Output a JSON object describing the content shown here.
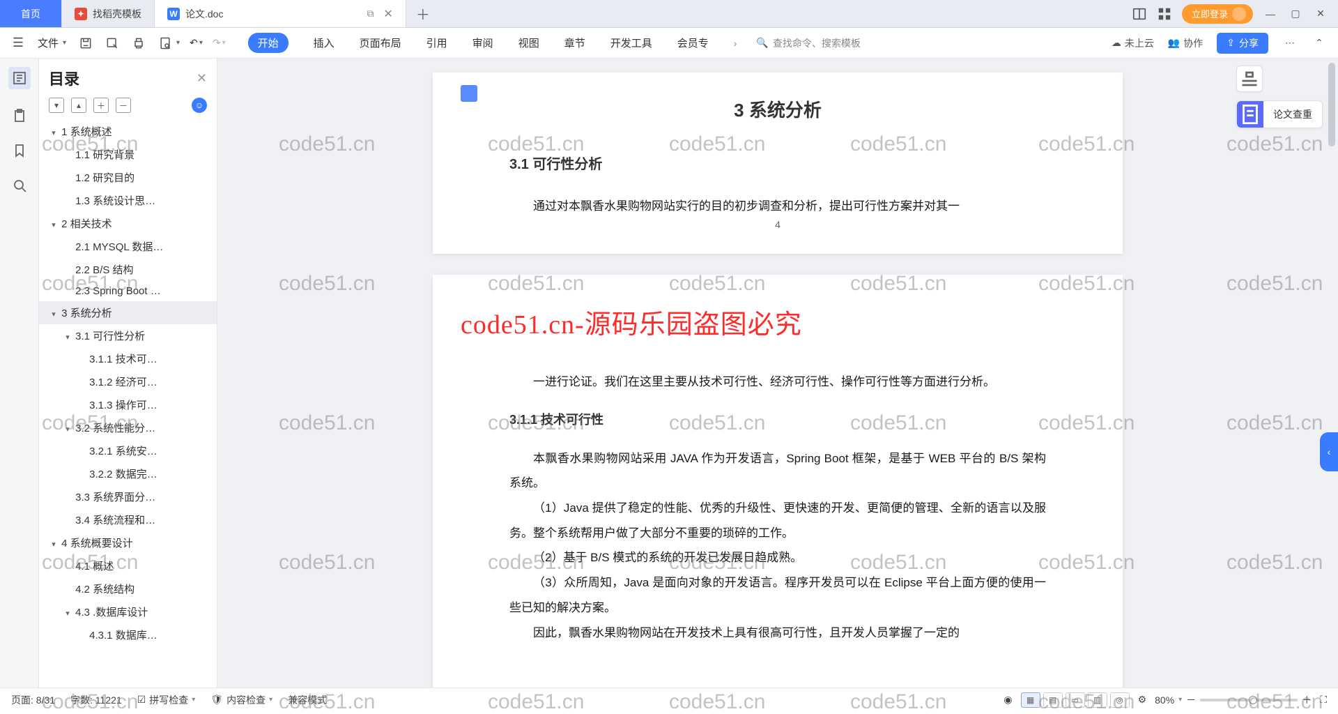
{
  "tabs": {
    "home": "首页",
    "t1": "找稻壳模板",
    "t2": "论文.doc",
    "login": "立即登录"
  },
  "menubar": {
    "file": "文件",
    "items": [
      "开始",
      "插入",
      "页面布局",
      "引用",
      "审阅",
      "视图",
      "章节",
      "开发工具",
      "会员专"
    ],
    "search": "查找命令、搜索模板",
    "cloud": "未上云",
    "collab": "协作",
    "share": "分享"
  },
  "outline": {
    "title": "目录",
    "tree": [
      {
        "lvl": 0,
        "chev": "▾",
        "t": "1 系统概述"
      },
      {
        "lvl": 1,
        "chev": "",
        "t": "1.1 研究背景"
      },
      {
        "lvl": 1,
        "chev": "",
        "t": "1.2 研究目的"
      },
      {
        "lvl": 1,
        "chev": "",
        "t": "1.3 系统设计思…"
      },
      {
        "lvl": 0,
        "chev": "▾",
        "t": "2 相关技术"
      },
      {
        "lvl": 1,
        "chev": "",
        "t": "2.1 MYSQL 数据…"
      },
      {
        "lvl": 1,
        "chev": "",
        "t": "2.2 B/S 结构"
      },
      {
        "lvl": 1,
        "chev": "",
        "t": "2.3 Spring Boot …"
      },
      {
        "lvl": 0,
        "chev": "▾",
        "t": "3 系统分析",
        "sel": true
      },
      {
        "lvl": 1,
        "chev": "▾",
        "t": "3.1 可行性分析"
      },
      {
        "lvl": 2,
        "chev": "",
        "t": "3.1.1 技术可…"
      },
      {
        "lvl": 2,
        "chev": "",
        "t": "3.1.2 经济可…"
      },
      {
        "lvl": 2,
        "chev": "",
        "t": "3.1.3 操作可…"
      },
      {
        "lvl": 1,
        "chev": "▾",
        "t": "3.2 系统性能分…"
      },
      {
        "lvl": 2,
        "chev": "",
        "t": "3.2.1 系统安…"
      },
      {
        "lvl": 2,
        "chev": "",
        "t": "3.2.2 数据完…"
      },
      {
        "lvl": 1,
        "chev": "",
        "t": "3.3 系统界面分…"
      },
      {
        "lvl": 1,
        "chev": "",
        "t": "3.4 系统流程和…"
      },
      {
        "lvl": 0,
        "chev": "▾",
        "t": "4 系统概要设计"
      },
      {
        "lvl": 1,
        "chev": "",
        "t": "4.1 概述"
      },
      {
        "lvl": 1,
        "chev": "",
        "t": "4.2 系统结构"
      },
      {
        "lvl": 1,
        "chev": "▾",
        "t": "4.3 .数据库设计"
      },
      {
        "lvl": 2,
        "chev": "",
        "t": "4.3.1 数据库…"
      }
    ]
  },
  "doc": {
    "h1": "3 系统分析",
    "h2": "3.1 可行性分析",
    "p0": "通过对本飘香水果购物网站实行的目的初步调查和分析，提出可行性方案并对其一",
    "pgnum": "4",
    "banner": "code51.cn-源码乐园盗图必究",
    "p1": "一进行论证。我们在这里主要从技术可行性、经济可行性、操作可行性等方面进行分析。",
    "h3": "3.1.1 技术可行性",
    "p2": "本飘香水果购物网站采用 JAVA 作为开发语言，Spring Boot 框架，是基于 WEB 平台的 B/S 架构系统。",
    "p3": "（1）Java 提供了稳定的性能、优秀的升级性、更快速的开发、更简便的管理、全新的语言以及服务。整个系统帮用户做了大部分不重要的琐碎的工作。",
    "p4": "（2）基于 B/S 模式的系统的开发已发展日趋成熟。",
    "p5": "（3）众所周知，Java 是面向对象的开发语言。程序开发员可以在 Eclipse 平台上面方便的使用一些已知的解决方案。",
    "p6": "因此，飘香水果购物网站在开发技术上具有很高可行性，且开发人员掌握了一定的"
  },
  "rpanel": {
    "check": "论文查重"
  },
  "status": {
    "page": "页面: 8/31",
    "words": "字数: 11221",
    "spell": "拼写检查",
    "content": "内容检查",
    "compat": "兼容模式",
    "zoom": "80%"
  },
  "watermark": "code51.cn"
}
